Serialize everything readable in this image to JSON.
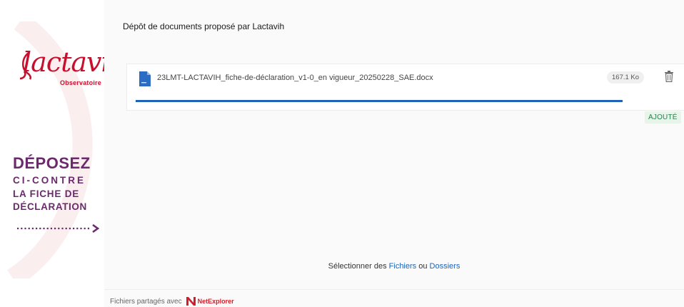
{
  "brand": {
    "logo_text": "lactavih",
    "logo_subtitle": "Observatoire",
    "accent": "#c8102e",
    "purple": "#6b2a6d"
  },
  "cta": {
    "line1": "DÉPOSEZ",
    "line2": "CI-CONTRE",
    "line3": "LA FICHE DE",
    "line4": "DÉCLARATION"
  },
  "main": {
    "title": "Dépôt de documents proposé par Lactavih"
  },
  "upload": {
    "file_name": "23LMT-LACTAVIH_fiche-de-déclaration_v1-0_en vigueur_20250228_SAE.docx",
    "file_size": "167.1 Ko",
    "status": "AJOUTÉ",
    "progress_fraction": 1.0,
    "icon": "word-document-icon"
  },
  "selector": {
    "prefix": "Sélectionner des",
    "files_link": "Fichiers",
    "conjunction": "ou",
    "folders_link": "Dossiers"
  },
  "footer": {
    "shared_with": "Fichiers partagés avec",
    "provider": "NetExplorer"
  }
}
